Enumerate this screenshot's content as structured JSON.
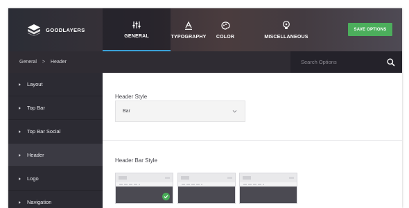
{
  "brand": {
    "name": "GOODLAYERS"
  },
  "tabs": [
    {
      "label": "GENERAL",
      "icon": "sliders-icon",
      "active": true
    },
    {
      "label": "TYPOGRAPHY",
      "icon": "typography-icon",
      "active": false
    },
    {
      "label": "COLOR",
      "icon": "palette-icon",
      "active": false
    },
    {
      "label": "MISCELLANEOUS",
      "icon": "lightbulb-icon",
      "active": false
    }
  ],
  "actions": {
    "save_label": "SAVE OPTIONS"
  },
  "breadcrumb": {
    "items": [
      "General",
      "Header"
    ],
    "separator": ">"
  },
  "search": {
    "placeholder": "Search Options"
  },
  "sidebar": {
    "items": [
      {
        "label": "Layout",
        "active": false
      },
      {
        "label": "Top Bar",
        "active": false
      },
      {
        "label": "Top Bar Social",
        "active": false
      },
      {
        "label": "Header",
        "active": true
      },
      {
        "label": "Logo",
        "active": false
      },
      {
        "label": "Navigation",
        "active": false
      }
    ]
  },
  "main": {
    "header_style": {
      "title": "Header Style",
      "value": "Bar"
    },
    "header_bar_style": {
      "title": "Header Bar Style",
      "options": 3,
      "selected_index": 0
    }
  },
  "colors": {
    "accent": "#3aa1d8",
    "save_button": "#4cae5c",
    "selected_check": "#49ac58",
    "sidebar_bg": "#2c2b33"
  }
}
